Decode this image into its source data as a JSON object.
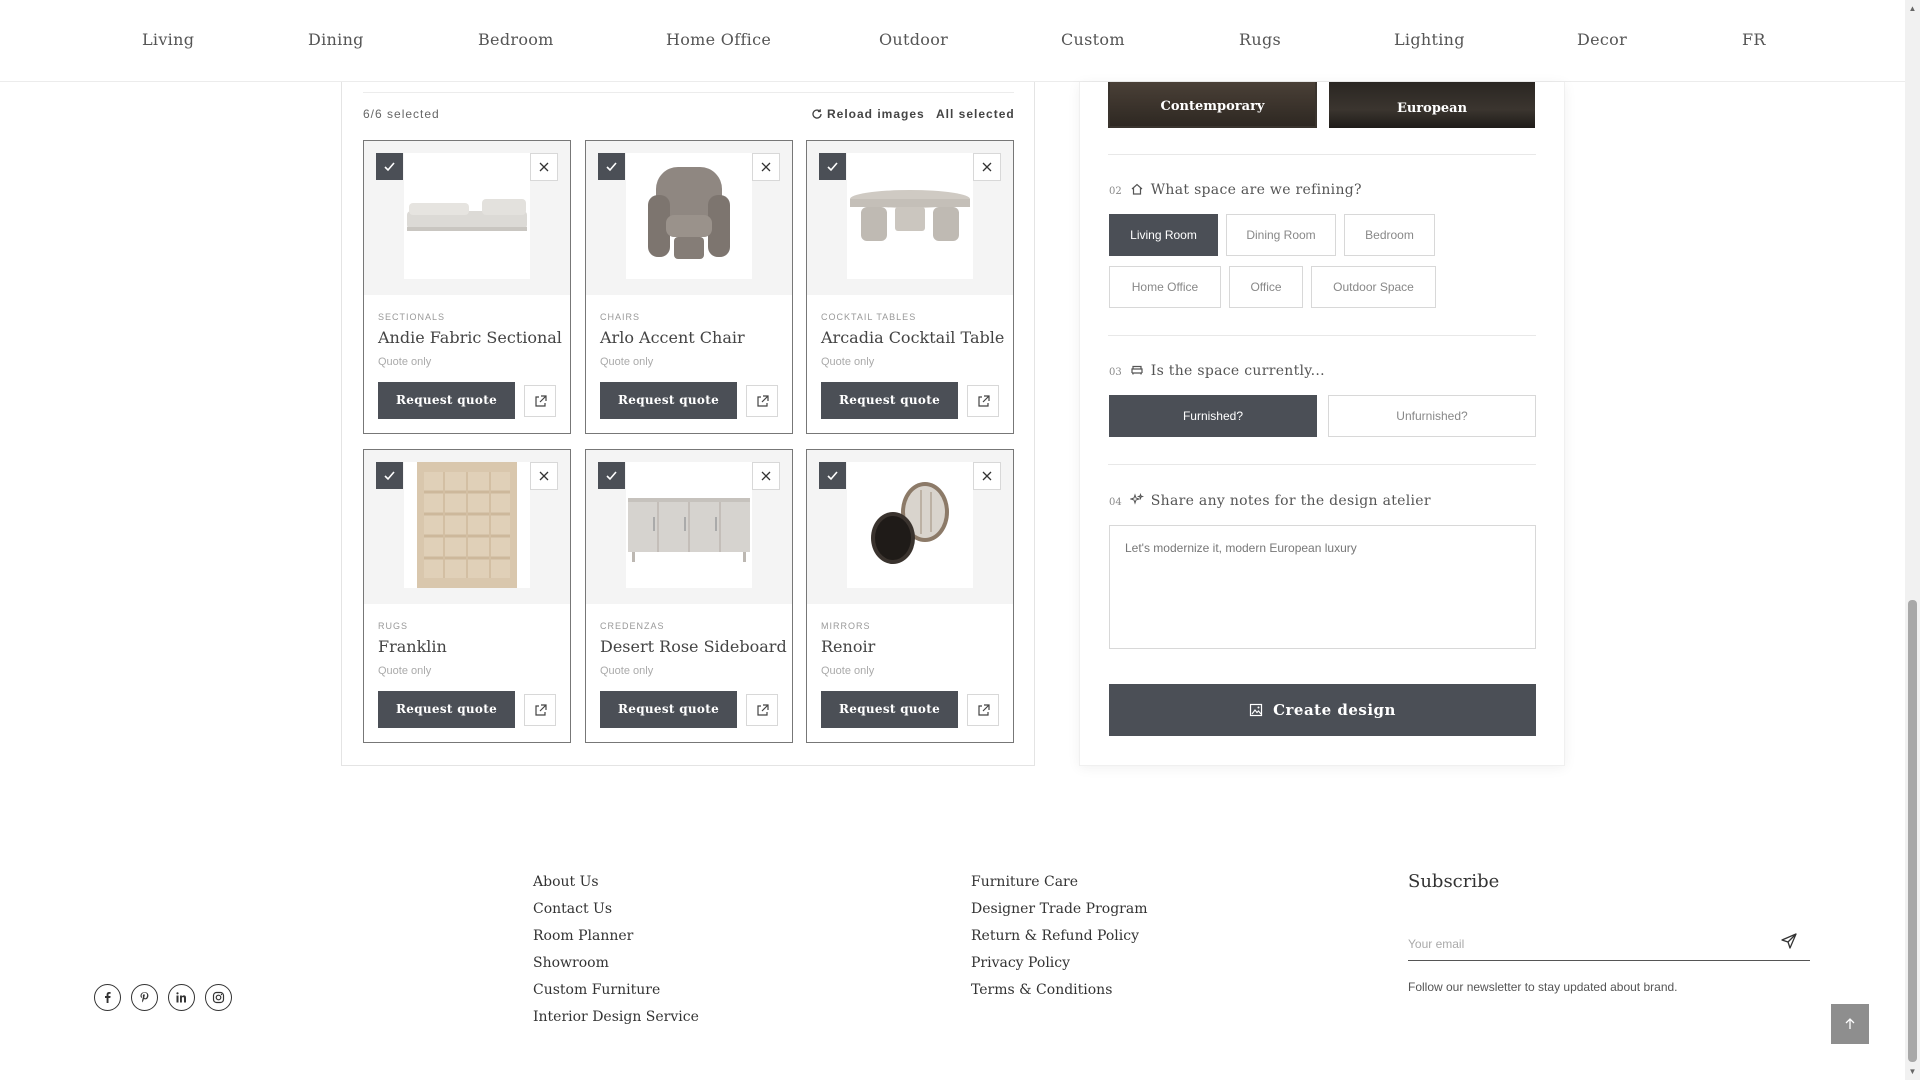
{
  "nav": {
    "items": [
      "Living",
      "Dining",
      "Bedroom",
      "Home Office",
      "Outdoor",
      "Custom",
      "Rugs",
      "Lighting",
      "Decor",
      "FR"
    ]
  },
  "grid": {
    "selected_count": "6/6 selected",
    "reload_label": "Reload images",
    "all_selected_label": "All selected",
    "request_label": "Request quote",
    "products": [
      {
        "category": "SECTIONALS",
        "name": "Andie Fabric Sectional",
        "price": "Quote only"
      },
      {
        "category": "CHAIRS",
        "name": "Arlo Accent Chair",
        "price": "Quote only"
      },
      {
        "category": "COCKTAIL TABLES",
        "name": "Arcadia Cocktail Table",
        "price": "Quote only"
      },
      {
        "category": "RUGS",
        "name": "Franklin",
        "price": "Quote only"
      },
      {
        "category": "CREDENZAS",
        "name": "Desert Rose Sideboard",
        "price": "Quote only"
      },
      {
        "category": "MIRRORS",
        "name": "Renoir",
        "price": "Quote only"
      }
    ]
  },
  "form": {
    "styles": [
      "Contemporary",
      "European"
    ],
    "q2": {
      "num": "02",
      "title": "What space are we refining?",
      "options": [
        "Living Room",
        "Dining Room",
        "Bedroom",
        "Home Office",
        "Office",
        "Outdoor Space"
      ],
      "selected": "Living Room"
    },
    "q3": {
      "num": "03",
      "title": "Is the space currently...",
      "options": [
        "Furnished?",
        "Unfurnished?"
      ],
      "selected": "Furnished?"
    },
    "q4": {
      "num": "04",
      "title": "Share any notes for the design atelier",
      "notes_value": "Let's modernize it, modern European luxury"
    },
    "create_label": "Create design"
  },
  "footer": {
    "col1": [
      "About Us",
      "Contact Us",
      "Room Planner",
      "Showroom",
      "Custom Furniture",
      "Interior Design Service"
    ],
    "col2": [
      "Furniture Care",
      "Designer Trade Program",
      "Return & Refund Policy",
      "Privacy Policy",
      "Terms & Conditions"
    ],
    "subscribe_title": "Subscribe",
    "email_placeholder": "Your email",
    "subscribe_note": "Follow our newsletter to stay updated about brand."
  },
  "colors": {
    "dark": "#4b4f56",
    "accent_gray": "#8e8e8e"
  },
  "icons": [
    "check-icon",
    "close-icon",
    "external-link-icon",
    "refresh-icon",
    "home-icon",
    "sofa-icon",
    "sparkle-icon",
    "image-edit-icon",
    "facebook-icon",
    "pinterest-icon",
    "linkedin-icon",
    "instagram-icon",
    "send-icon",
    "arrow-up-icon"
  ]
}
